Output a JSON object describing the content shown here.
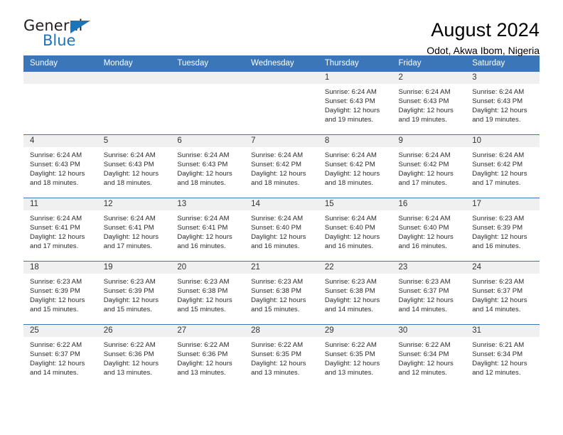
{
  "logo": {
    "word_top": "General",
    "word_bottom": "Blue",
    "brand_color": "#1b75bb",
    "dark_color": "#231f20"
  },
  "header": {
    "title": "August 2024",
    "subtitle": "Odot, Akwa Ibom, Nigeria"
  },
  "theme": {
    "header_row_bg": "#3a76b8",
    "daynum_band_bg": "#f0f0f0",
    "row_border": "#3a76b8"
  },
  "weekday_headers": [
    "Sunday",
    "Monday",
    "Tuesday",
    "Wednesday",
    "Thursday",
    "Friday",
    "Saturday"
  ],
  "weeks": [
    [
      {
        "day": "",
        "sunrise": "",
        "sunset": "",
        "daylight_line1": "",
        "daylight_line2": ""
      },
      {
        "day": "",
        "sunrise": "",
        "sunset": "",
        "daylight_line1": "",
        "daylight_line2": ""
      },
      {
        "day": "",
        "sunrise": "",
        "sunset": "",
        "daylight_line1": "",
        "daylight_line2": ""
      },
      {
        "day": "",
        "sunrise": "",
        "sunset": "",
        "daylight_line1": "",
        "daylight_line2": ""
      },
      {
        "day": "1",
        "sunrise": "Sunrise: 6:24 AM",
        "sunset": "Sunset: 6:43 PM",
        "daylight_line1": "Daylight: 12 hours",
        "daylight_line2": "and 19 minutes."
      },
      {
        "day": "2",
        "sunrise": "Sunrise: 6:24 AM",
        "sunset": "Sunset: 6:43 PM",
        "daylight_line1": "Daylight: 12 hours",
        "daylight_line2": "and 19 minutes."
      },
      {
        "day": "3",
        "sunrise": "Sunrise: 6:24 AM",
        "sunset": "Sunset: 6:43 PM",
        "daylight_line1": "Daylight: 12 hours",
        "daylight_line2": "and 19 minutes."
      }
    ],
    [
      {
        "day": "4",
        "sunrise": "Sunrise: 6:24 AM",
        "sunset": "Sunset: 6:43 PM",
        "daylight_line1": "Daylight: 12 hours",
        "daylight_line2": "and 18 minutes."
      },
      {
        "day": "5",
        "sunrise": "Sunrise: 6:24 AM",
        "sunset": "Sunset: 6:43 PM",
        "daylight_line1": "Daylight: 12 hours",
        "daylight_line2": "and 18 minutes."
      },
      {
        "day": "6",
        "sunrise": "Sunrise: 6:24 AM",
        "sunset": "Sunset: 6:43 PM",
        "daylight_line1": "Daylight: 12 hours",
        "daylight_line2": "and 18 minutes."
      },
      {
        "day": "7",
        "sunrise": "Sunrise: 6:24 AM",
        "sunset": "Sunset: 6:42 PM",
        "daylight_line1": "Daylight: 12 hours",
        "daylight_line2": "and 18 minutes."
      },
      {
        "day": "8",
        "sunrise": "Sunrise: 6:24 AM",
        "sunset": "Sunset: 6:42 PM",
        "daylight_line1": "Daylight: 12 hours",
        "daylight_line2": "and 18 minutes."
      },
      {
        "day": "9",
        "sunrise": "Sunrise: 6:24 AM",
        "sunset": "Sunset: 6:42 PM",
        "daylight_line1": "Daylight: 12 hours",
        "daylight_line2": "and 17 minutes."
      },
      {
        "day": "10",
        "sunrise": "Sunrise: 6:24 AM",
        "sunset": "Sunset: 6:42 PM",
        "daylight_line1": "Daylight: 12 hours",
        "daylight_line2": "and 17 minutes."
      }
    ],
    [
      {
        "day": "11",
        "sunrise": "Sunrise: 6:24 AM",
        "sunset": "Sunset: 6:41 PM",
        "daylight_line1": "Daylight: 12 hours",
        "daylight_line2": "and 17 minutes."
      },
      {
        "day": "12",
        "sunrise": "Sunrise: 6:24 AM",
        "sunset": "Sunset: 6:41 PM",
        "daylight_line1": "Daylight: 12 hours",
        "daylight_line2": "and 17 minutes."
      },
      {
        "day": "13",
        "sunrise": "Sunrise: 6:24 AM",
        "sunset": "Sunset: 6:41 PM",
        "daylight_line1": "Daylight: 12 hours",
        "daylight_line2": "and 16 minutes."
      },
      {
        "day": "14",
        "sunrise": "Sunrise: 6:24 AM",
        "sunset": "Sunset: 6:40 PM",
        "daylight_line1": "Daylight: 12 hours",
        "daylight_line2": "and 16 minutes."
      },
      {
        "day": "15",
        "sunrise": "Sunrise: 6:24 AM",
        "sunset": "Sunset: 6:40 PM",
        "daylight_line1": "Daylight: 12 hours",
        "daylight_line2": "and 16 minutes."
      },
      {
        "day": "16",
        "sunrise": "Sunrise: 6:24 AM",
        "sunset": "Sunset: 6:40 PM",
        "daylight_line1": "Daylight: 12 hours",
        "daylight_line2": "and 16 minutes."
      },
      {
        "day": "17",
        "sunrise": "Sunrise: 6:23 AM",
        "sunset": "Sunset: 6:39 PM",
        "daylight_line1": "Daylight: 12 hours",
        "daylight_line2": "and 16 minutes."
      }
    ],
    [
      {
        "day": "18",
        "sunrise": "Sunrise: 6:23 AM",
        "sunset": "Sunset: 6:39 PM",
        "daylight_line1": "Daylight: 12 hours",
        "daylight_line2": "and 15 minutes."
      },
      {
        "day": "19",
        "sunrise": "Sunrise: 6:23 AM",
        "sunset": "Sunset: 6:39 PM",
        "daylight_line1": "Daylight: 12 hours",
        "daylight_line2": "and 15 minutes."
      },
      {
        "day": "20",
        "sunrise": "Sunrise: 6:23 AM",
        "sunset": "Sunset: 6:38 PM",
        "daylight_line1": "Daylight: 12 hours",
        "daylight_line2": "and 15 minutes."
      },
      {
        "day": "21",
        "sunrise": "Sunrise: 6:23 AM",
        "sunset": "Sunset: 6:38 PM",
        "daylight_line1": "Daylight: 12 hours",
        "daylight_line2": "and 15 minutes."
      },
      {
        "day": "22",
        "sunrise": "Sunrise: 6:23 AM",
        "sunset": "Sunset: 6:38 PM",
        "daylight_line1": "Daylight: 12 hours",
        "daylight_line2": "and 14 minutes."
      },
      {
        "day": "23",
        "sunrise": "Sunrise: 6:23 AM",
        "sunset": "Sunset: 6:37 PM",
        "daylight_line1": "Daylight: 12 hours",
        "daylight_line2": "and 14 minutes."
      },
      {
        "day": "24",
        "sunrise": "Sunrise: 6:23 AM",
        "sunset": "Sunset: 6:37 PM",
        "daylight_line1": "Daylight: 12 hours",
        "daylight_line2": "and 14 minutes."
      }
    ],
    [
      {
        "day": "25",
        "sunrise": "Sunrise: 6:22 AM",
        "sunset": "Sunset: 6:37 PM",
        "daylight_line1": "Daylight: 12 hours",
        "daylight_line2": "and 14 minutes."
      },
      {
        "day": "26",
        "sunrise": "Sunrise: 6:22 AM",
        "sunset": "Sunset: 6:36 PM",
        "daylight_line1": "Daylight: 12 hours",
        "daylight_line2": "and 13 minutes."
      },
      {
        "day": "27",
        "sunrise": "Sunrise: 6:22 AM",
        "sunset": "Sunset: 6:36 PM",
        "daylight_line1": "Daylight: 12 hours",
        "daylight_line2": "and 13 minutes."
      },
      {
        "day": "28",
        "sunrise": "Sunrise: 6:22 AM",
        "sunset": "Sunset: 6:35 PM",
        "daylight_line1": "Daylight: 12 hours",
        "daylight_line2": "and 13 minutes."
      },
      {
        "day": "29",
        "sunrise": "Sunrise: 6:22 AM",
        "sunset": "Sunset: 6:35 PM",
        "daylight_line1": "Daylight: 12 hours",
        "daylight_line2": "and 13 minutes."
      },
      {
        "day": "30",
        "sunrise": "Sunrise: 6:22 AM",
        "sunset": "Sunset: 6:34 PM",
        "daylight_line1": "Daylight: 12 hours",
        "daylight_line2": "and 12 minutes."
      },
      {
        "day": "31",
        "sunrise": "Sunrise: 6:21 AM",
        "sunset": "Sunset: 6:34 PM",
        "daylight_line1": "Daylight: 12 hours",
        "daylight_line2": "and 12 minutes."
      }
    ]
  ]
}
